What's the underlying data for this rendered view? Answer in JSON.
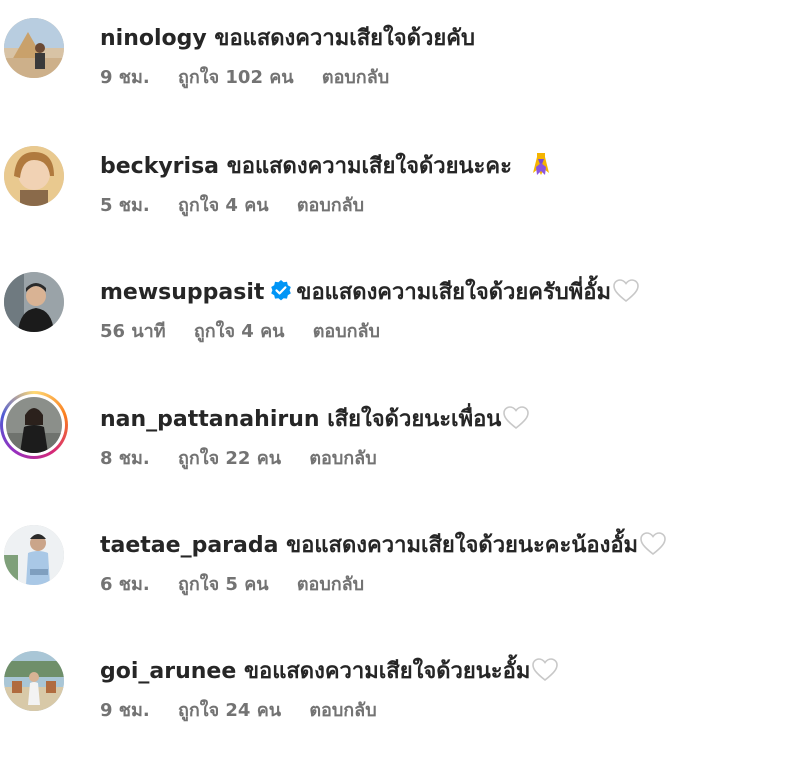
{
  "comments": [
    {
      "username": "ninology",
      "text": "ขอแสดงความเสียใจด้วยคับ",
      "time": "9 ชม.",
      "likes": "ถูกใจ 102 คน",
      "reply": "ตอบกลับ"
    },
    {
      "username": "beckyrisa",
      "text": "ขอแสดงความเสียใจด้วยนะคะ",
      "time": "5 ชม.",
      "likes": "ถูกใจ 4 คน",
      "reply": "ตอบกลับ",
      "emoji": "ribbon-icon"
    },
    {
      "username": "mewsuppasit",
      "text": "ขอแสดงความเสียใจด้วยครับพี่อั้ม",
      "time": "56 นาที",
      "likes": "ถูกใจ 4 คน",
      "reply": "ตอบกลับ",
      "verified": true,
      "heart": true
    },
    {
      "username": "nan_pattanahirun",
      "text": "เสียใจด้วยนะเพื่อน",
      "time": "8 ชม.",
      "likes": "ถูกใจ 22 คน",
      "reply": "ตอบกลับ",
      "story_ring": true,
      "heart": true
    },
    {
      "username": "taetae_parada",
      "text": "ขอแสดงความเสียใจด้วยนะคะน้องอั้ม",
      "time": "6 ชม.",
      "likes": "ถูกใจ 5 คน",
      "reply": "ตอบกลับ",
      "heart": true
    },
    {
      "username": "goi_arunee",
      "text": "ขอแสดงความเสียใจด้วยนะอั้ม",
      "time": "9 ชม.",
      "likes": "ถูกใจ 24 คน",
      "reply": "ตอบกลับ",
      "heart": true
    }
  ],
  "colors": {
    "text": "#262626",
    "meta": "#737373",
    "verified": "#0095f6"
  }
}
